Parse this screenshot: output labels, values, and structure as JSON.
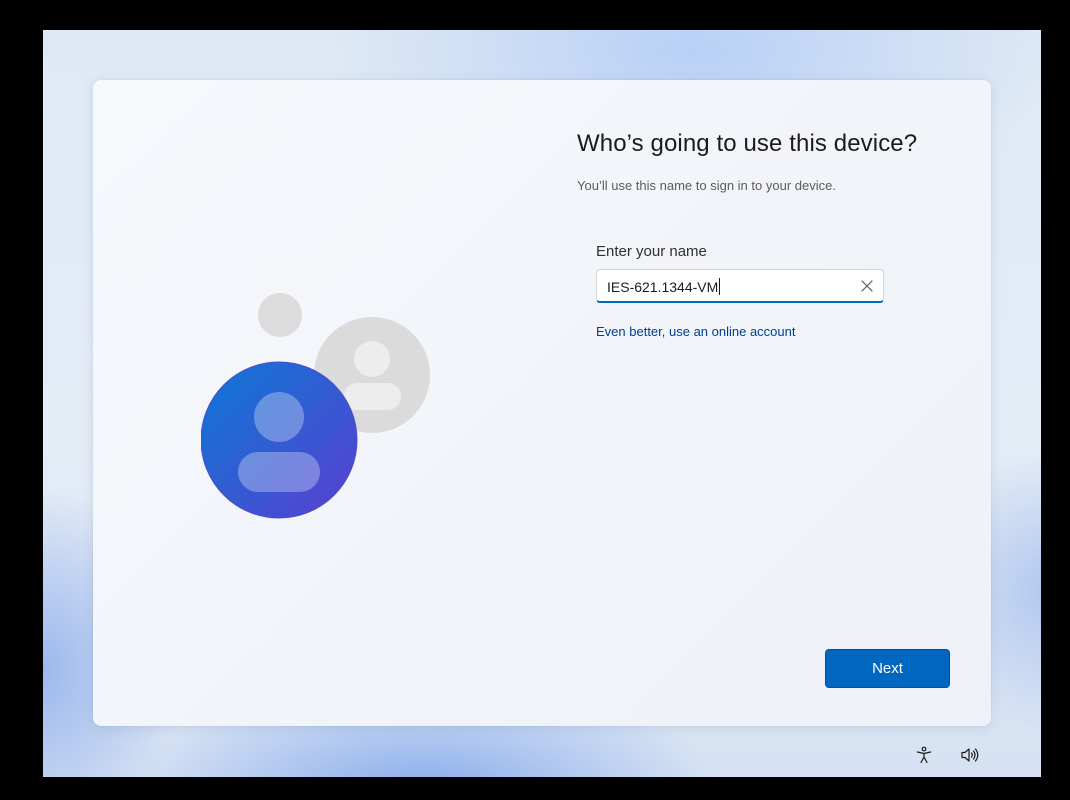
{
  "page": {
    "title": "Who’s going to use this device?",
    "subtitle": "You’ll use this name to sign in to your device."
  },
  "name_field": {
    "label": "Enter your name",
    "value": "IES-621.1344-VM"
  },
  "online_account_link": "Even better, use an online account",
  "next_button": "Next",
  "icons": {
    "illustration": "people-illustration-icon",
    "clear": "close-icon",
    "accessibility": "accessibility-icon",
    "volume": "speaker-icon"
  },
  "colors": {
    "accent": "#0067c0",
    "link": "#003e92",
    "avatar_gradient_start": "#0a79d6",
    "avatar_gradient_end": "#5a3fcf"
  }
}
